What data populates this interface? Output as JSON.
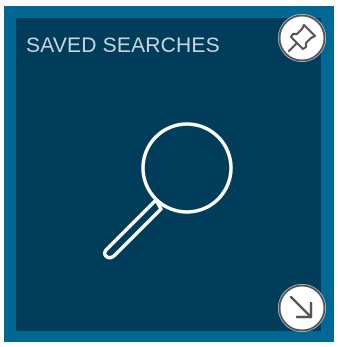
{
  "tile": {
    "title": "SAVED SEARCHES",
    "main_icon": "search-icon",
    "pin_icon": "pin-icon",
    "open_icon": "arrow-down-right-icon"
  },
  "colors": {
    "tile_border": "#006892",
    "tile_background": "#003d5b",
    "title_text": "#c9d6de",
    "icon_stroke": "#ffffff",
    "button_background": "#ffffff",
    "button_icon": "#555555"
  }
}
